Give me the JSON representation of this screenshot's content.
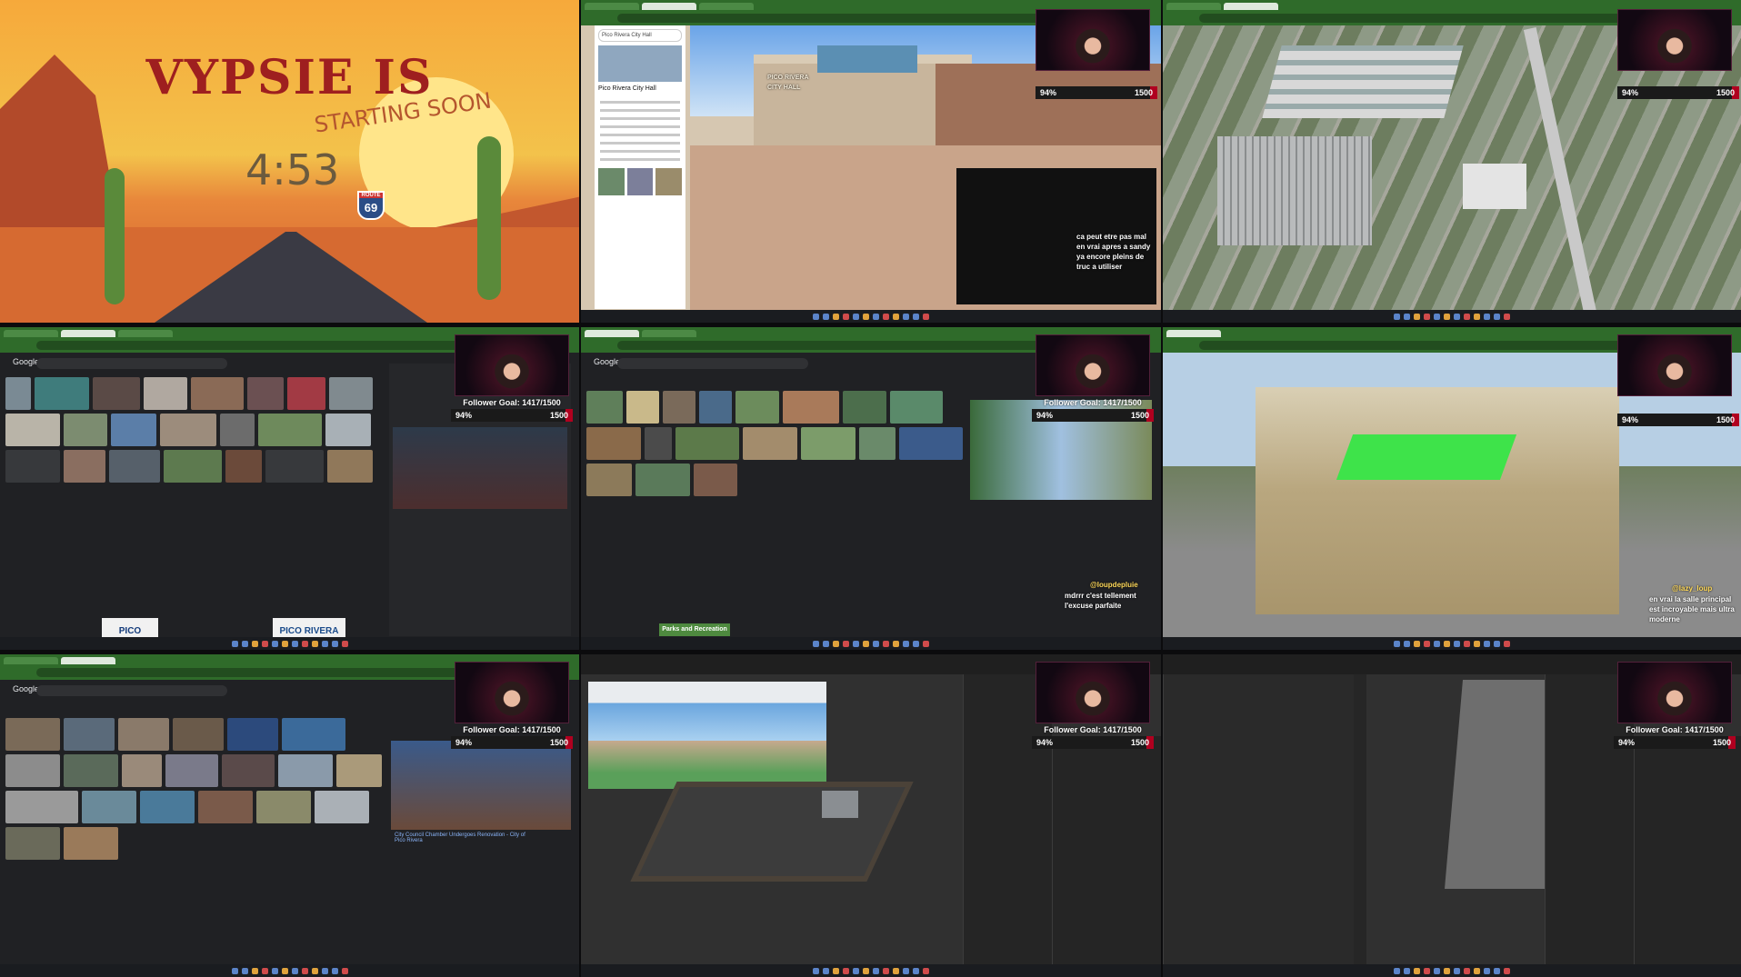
{
  "overlay": {
    "follower_goal": "Follower Goal: 1417/1500",
    "goal_percent_label": "94%",
    "goal_target_label": "1500",
    "goal_progress": 0.94
  },
  "tile1": {
    "title": "VYPSIE IS",
    "subtitle": "STARTING SOON",
    "timer": "4:53",
    "route_label": "ROUTE",
    "route_number": "69"
  },
  "tile2": {
    "place_name": "Pico Rivera City Hall",
    "search_value": "Pico Rivera City Hall",
    "sign_text": "PICO RIVERA CITY HALL",
    "chat_caption": "ca peut etre pas mal en vrai apres a sandy ya encore pleins de truc a utiliser"
  },
  "tile4": {
    "google_label": "Google",
    "pico_logo_1": "PICO RIVERA",
    "pico_logo_2": "PICO RIVERA"
  },
  "tile5": {
    "google_label": "Google",
    "chat_caption_user": "@loupdepluie",
    "chat_caption": "mdrrr c'est tellement l'excuse parfaite",
    "promo_text": "Parks and Recreation"
  },
  "tile6": {
    "chat_caption_user": "@lazy_loup",
    "chat_caption": "en vrai la salle principal est incroyable mais ultra moderne"
  },
  "tile7": {
    "google_label": "Google",
    "result_title": "City Council Chamber Undergoes Renovation - City of Pico Rivera"
  }
}
